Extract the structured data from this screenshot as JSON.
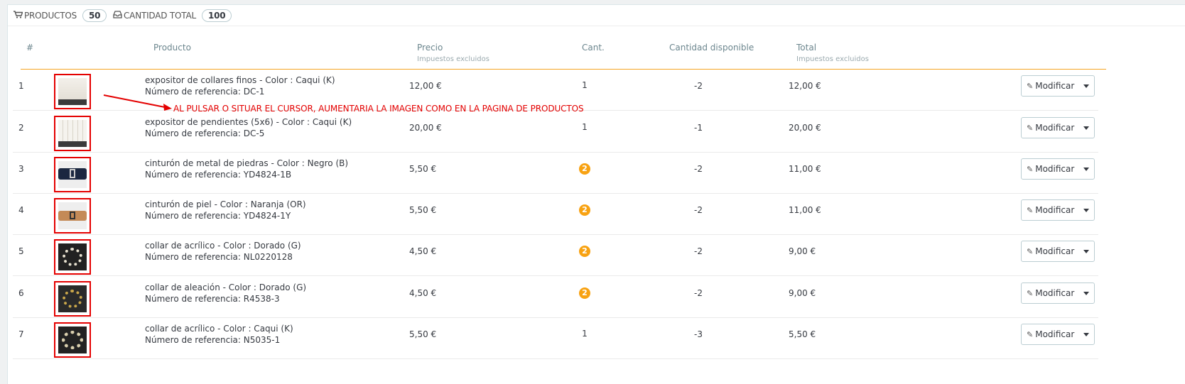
{
  "summary": {
    "products_icon": "cart-icon",
    "products_label": "PRODUCTOS",
    "products_count": "50",
    "quantity_icon": "inbox-icon",
    "quantity_label": "CANTIDAD TOTAL",
    "quantity_count": "100"
  },
  "table": {
    "headers": {
      "num": "#",
      "product": "Producto",
      "price": "Precio",
      "price_sub": "Impuestos excluidos",
      "qty": "Cant.",
      "available": "Cantidad disponible",
      "total": "Total",
      "total_sub": "Impuestos excluidos"
    },
    "rows": [
      {
        "num": "1",
        "name": "expositor de collares finos - Color : Caqui (K)",
        "ref": "Número de referencia: DC-1",
        "price": "12,00 €",
        "qty": "1",
        "qty_badge": false,
        "available": "-2",
        "total": "12,00 €",
        "action": "Modificar"
      },
      {
        "num": "2",
        "name": "expositor de pendientes (5x6) - Color : Caqui (K)",
        "ref": "Número de referencia: DC-5",
        "price": "20,00 €",
        "qty": "1",
        "qty_badge": false,
        "available": "-1",
        "total": "20,00 €",
        "action": "Modificar"
      },
      {
        "num": "3",
        "name": "cinturón de metal de piedras - Color : Negro (B)",
        "ref": "Número de referencia: YD4824-1B",
        "price": "5,50 €",
        "qty": "2",
        "qty_badge": true,
        "available": "-2",
        "total": "11,00 €",
        "action": "Modificar"
      },
      {
        "num": "4",
        "name": "cinturón de piel - Color : Naranja (OR)",
        "ref": "Número de referencia: YD4824-1Y",
        "price": "5,50 €",
        "qty": "2",
        "qty_badge": true,
        "available": "-2",
        "total": "11,00 €",
        "action": "Modificar"
      },
      {
        "num": "5",
        "name": "collar de acrílico - Color : Dorado (G)",
        "ref": "Número de referencia: NL0220128",
        "price": "4,50 €",
        "qty": "2",
        "qty_badge": true,
        "available": "-2",
        "total": "9,00 €",
        "action": "Modificar"
      },
      {
        "num": "6",
        "name": "collar de aleación - Color : Dorado (G)",
        "ref": "Número de referencia: R4538-3",
        "price": "4,50 €",
        "qty": "2",
        "qty_badge": true,
        "available": "-2",
        "total": "9,00 €",
        "action": "Modificar"
      },
      {
        "num": "7",
        "name": "collar de acrílico - Color : Caqui (K)",
        "ref": "Número de referencia: N5035-1",
        "price": "5,50 €",
        "qty": "1",
        "qty_badge": false,
        "available": "-3",
        "total": "5,50 €",
        "action": "Modificar"
      }
    ]
  },
  "annotation": {
    "text": "AL PULSAR O SITUAR EL CURSOR, AUMENTARIA LA IMAGEN COMO EN LA PAGINA DE PRODUCTOS",
    "color": "#e40000"
  },
  "colors": {
    "accent_rule": "#f5a623",
    "qty_badge": "#f8a212",
    "highlight_border": "#e40000"
  }
}
